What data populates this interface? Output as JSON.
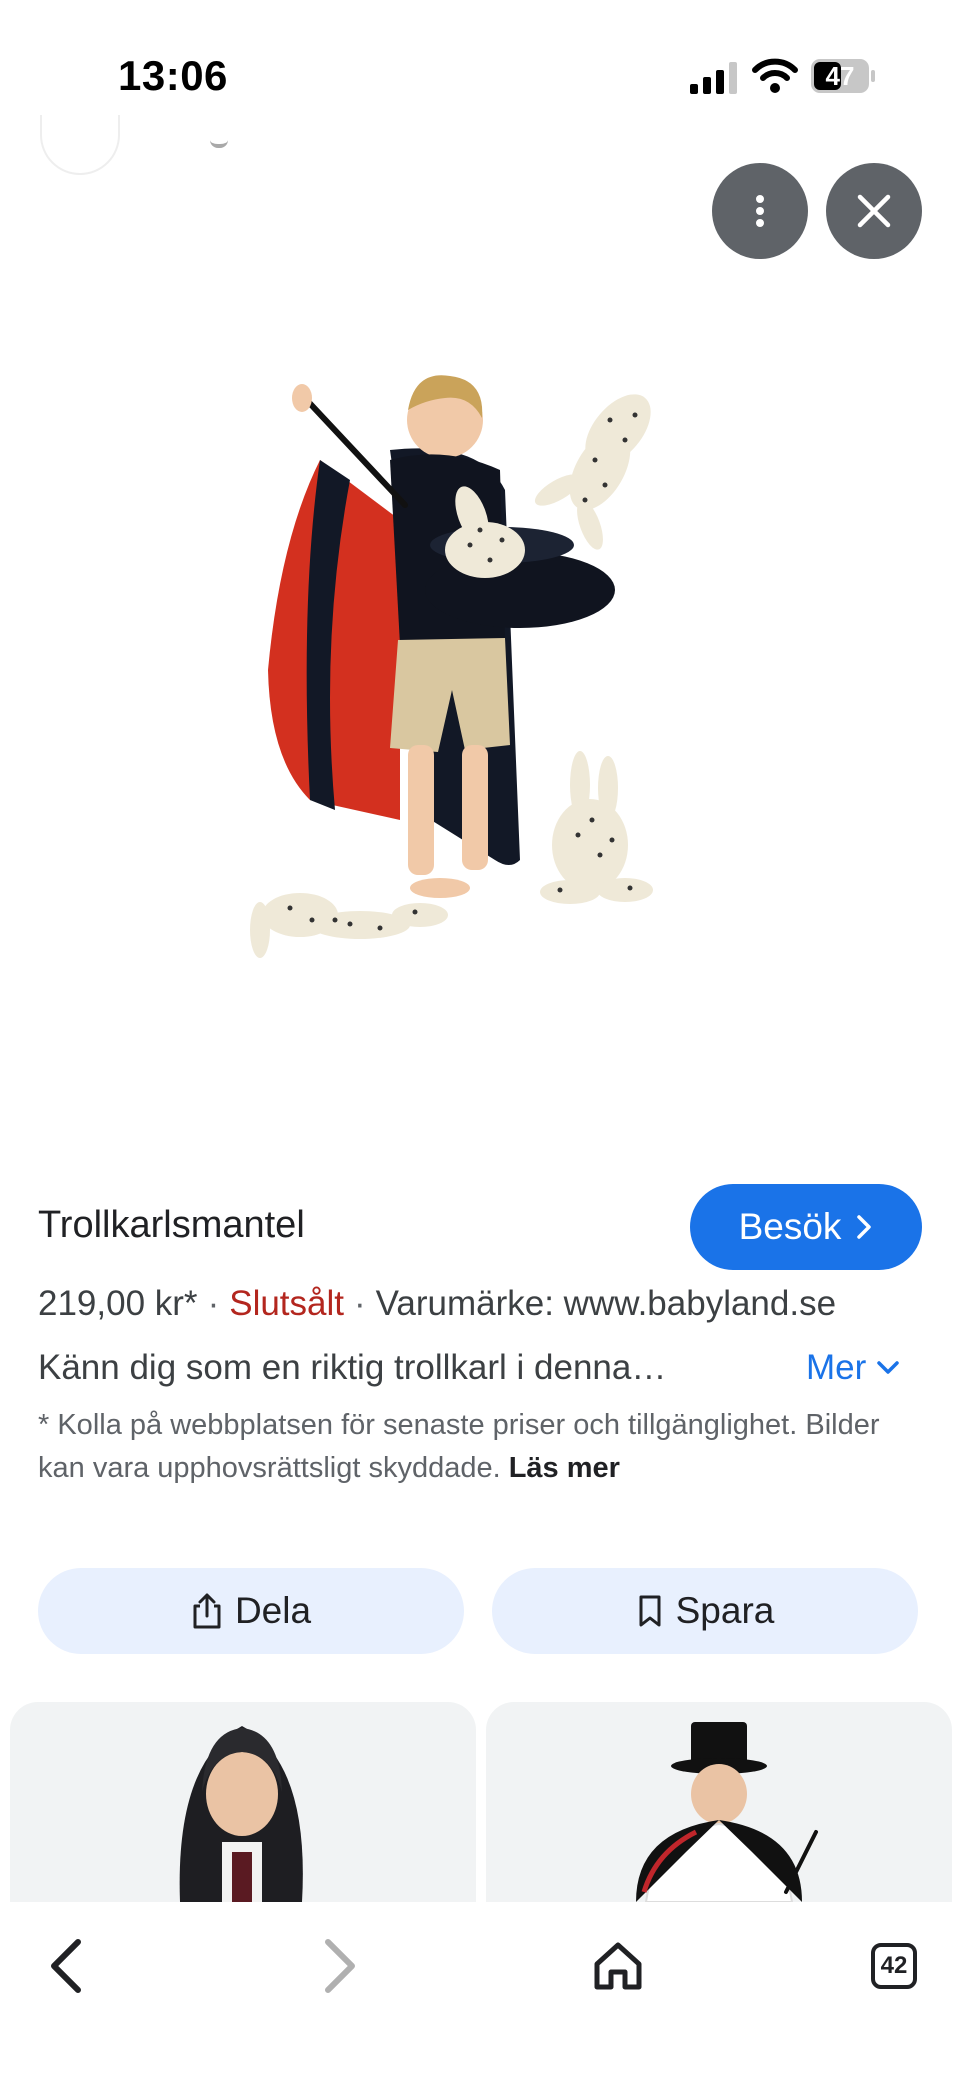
{
  "status_bar": {
    "time": "13:06",
    "battery": "47"
  },
  "overlay": {
    "more_icon": "more-vertical-icon",
    "close_icon": "close-icon"
  },
  "product": {
    "title": "Trollkarlsmantel",
    "visit_label": "Besök",
    "price": "219,00 kr*",
    "stock_status": "Slutsålt",
    "brand": "Varumärke: www.babyland.se",
    "description": "Känn dig som en riktig trollkarl i denna…",
    "more_label": "Mer",
    "disclaimer": "* Kolla på webbplatsen för senaste priser och tillgänglighet. Bilder kan vara upphovsrättsligt skyddade.",
    "read_more_label": "Läs mer"
  },
  "actions": {
    "share_label": "Dela",
    "save_label": "Spara"
  },
  "nav": {
    "tab_count": "42"
  },
  "colors": {
    "accent": "#1a73e8",
    "soldout": "#b3261e",
    "action_bg": "#e8f0fe",
    "overlay_button": "#5f6368"
  }
}
